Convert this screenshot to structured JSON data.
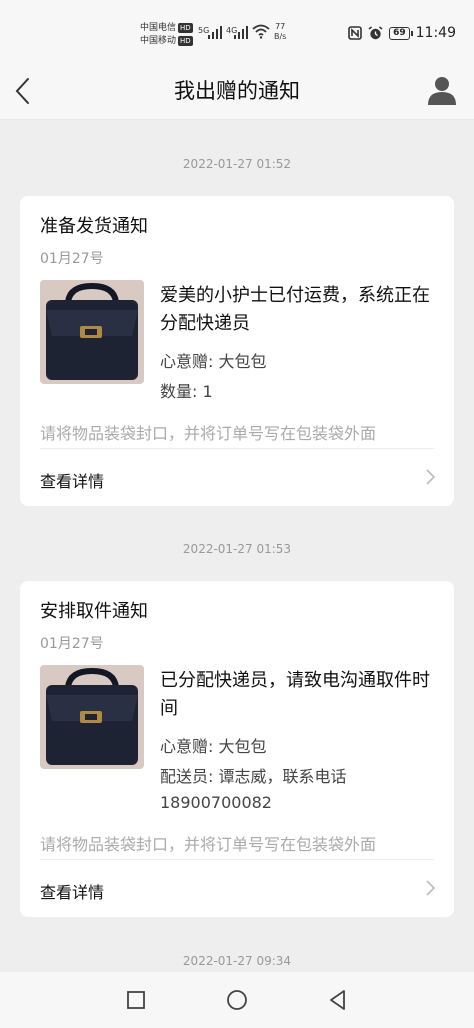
{
  "status_bar": {
    "carrier1": "中国电信",
    "carrier2": "中国移动",
    "hd": "HD",
    "net1": "5G",
    "net2": "4G",
    "speed_value": "77",
    "speed_unit": "B/s",
    "battery": "69",
    "time": "11:49"
  },
  "header": {
    "title": "我出赠的通知",
    "back_icon": "chevron-left-icon",
    "user_icon": "user-icon"
  },
  "timestamps": [
    "2022-01-27 01:52",
    "2022-01-27 01:53",
    "2022-01-27 09:34"
  ],
  "cards": [
    {
      "title": "准备发货通知",
      "date": "01月27号",
      "message": "爱美的小护士已付运费，系统正在分配快递员",
      "gift": "心意赠: 大包包",
      "extra": "数量: 1",
      "hint": "请将物品装袋封口，并将订单号写在包装袋外面",
      "more": "查看详情"
    },
    {
      "title": "安排取件通知",
      "date": "01月27号",
      "message": "已分配快递员，请致电沟通取件时间",
      "gift": "心意赠: 大包包",
      "extra": "配送员: 谭志威，联系电话",
      "extra2": "18900700082",
      "hint": "请将物品装袋封口，并将订单号写在包装袋外面",
      "more": "查看详情"
    }
  ],
  "colors": {
    "background": "#eeeeee",
    "card": "#ffffff",
    "muted": "#999999",
    "bag": "#1e2333"
  }
}
